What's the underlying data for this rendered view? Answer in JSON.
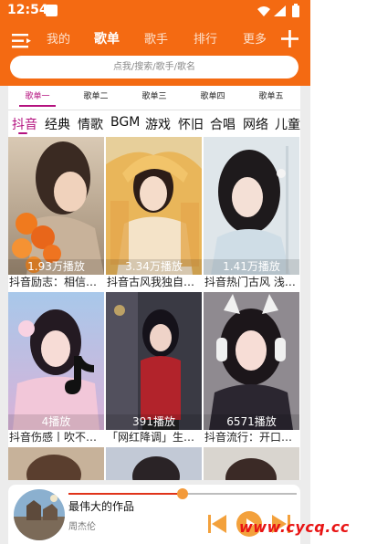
{
  "status_bar": {
    "time": "12:54"
  },
  "header": {
    "tabs": [
      {
        "label": "我的"
      },
      {
        "label": "歌单"
      },
      {
        "label": "歌手"
      },
      {
        "label": "排行"
      },
      {
        "label": "更多"
      }
    ],
    "active_tab": "歌单",
    "search_placeholder": "点我/搜索/歌手/歌名"
  },
  "subtabs": [
    {
      "label": "歌单一"
    },
    {
      "label": "歌单二"
    },
    {
      "label": "歌单三"
    },
    {
      "label": "歌单四"
    },
    {
      "label": "歌单五"
    }
  ],
  "categories": [
    {
      "label": "抖音"
    },
    {
      "label": "经典"
    },
    {
      "label": "情歌"
    },
    {
      "label": "BGM"
    },
    {
      "label": "游戏"
    },
    {
      "label": "怀旧"
    },
    {
      "label": "合唱"
    },
    {
      "label": "网络"
    },
    {
      "label": "儿童"
    }
  ],
  "cards": [
    {
      "plays": "1.93万播放",
      "title": "抖音励志：相信…"
    },
    {
      "plays": "3.34万播放",
      "title": "抖音古风我独自…"
    },
    {
      "plays": "1.41万播放",
      "title": "抖音热门古风 浅…"
    },
    {
      "plays": "4播放",
      "title": "抖音伤感丨吹不…"
    },
    {
      "plays": "391播放",
      "title": "「网红降调」生…"
    },
    {
      "plays": "6571播放",
      "title": "抖音流行：开口…"
    }
  ],
  "player": {
    "song": "最伟大的作品",
    "artist": "周杰伦",
    "progress": 0.5
  },
  "watermark": "www.cycq.cc",
  "colors": {
    "accent": "#f46a12",
    "active_tab": "#b4127f",
    "knob": "#f39a3a",
    "watermark": "#e81414"
  }
}
